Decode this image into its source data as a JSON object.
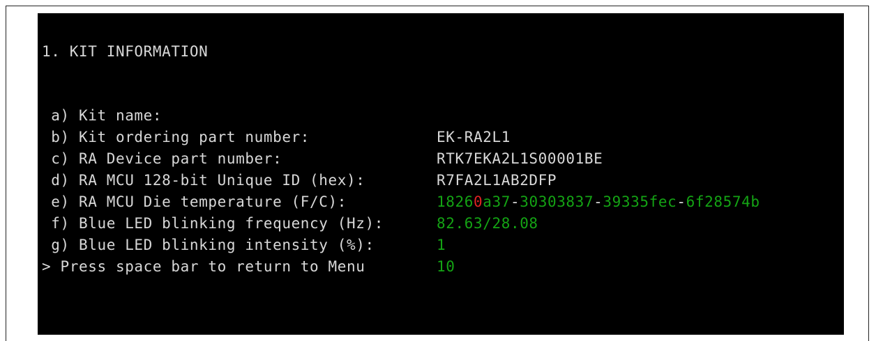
{
  "terminal": {
    "heading": "1. KIT INFORMATION",
    "items": [
      {
        "label": " a) Kit name:",
        "value": "EK-RA2L1"
      },
      {
        "label": " b) Kit ordering part number:",
        "value": "RTK7EKA2L1S00001BE"
      },
      {
        "label": " c) RA Device part number:",
        "value": "R7FA2L1AB2DFP"
      },
      {
        "label": " d) RA MCU 128-bit Unique ID (hex):"
      },
      {
        "label": " e) RA MCU Die temperature (F/C):",
        "value": "82.63/28.08"
      },
      {
        "label": " f) Blue LED blinking frequency (Hz):",
        "value": "1"
      },
      {
        "label": " g) Blue LED blinking intensity (%):",
        "value": "10"
      }
    ],
    "unique_id": {
      "part1_a": "1826",
      "part1_red": "0",
      "part1_b": "a37",
      "sep": "-",
      "part2": "30303837",
      "part3": "39335fec",
      "part4": "6f28574b"
    },
    "prompt": "> Press space bar to return to Menu",
    "colors": {
      "background": "#000000",
      "text": "#d8d8d8",
      "value_green": "#14a314",
      "highlight_red": "#e02222"
    }
  }
}
